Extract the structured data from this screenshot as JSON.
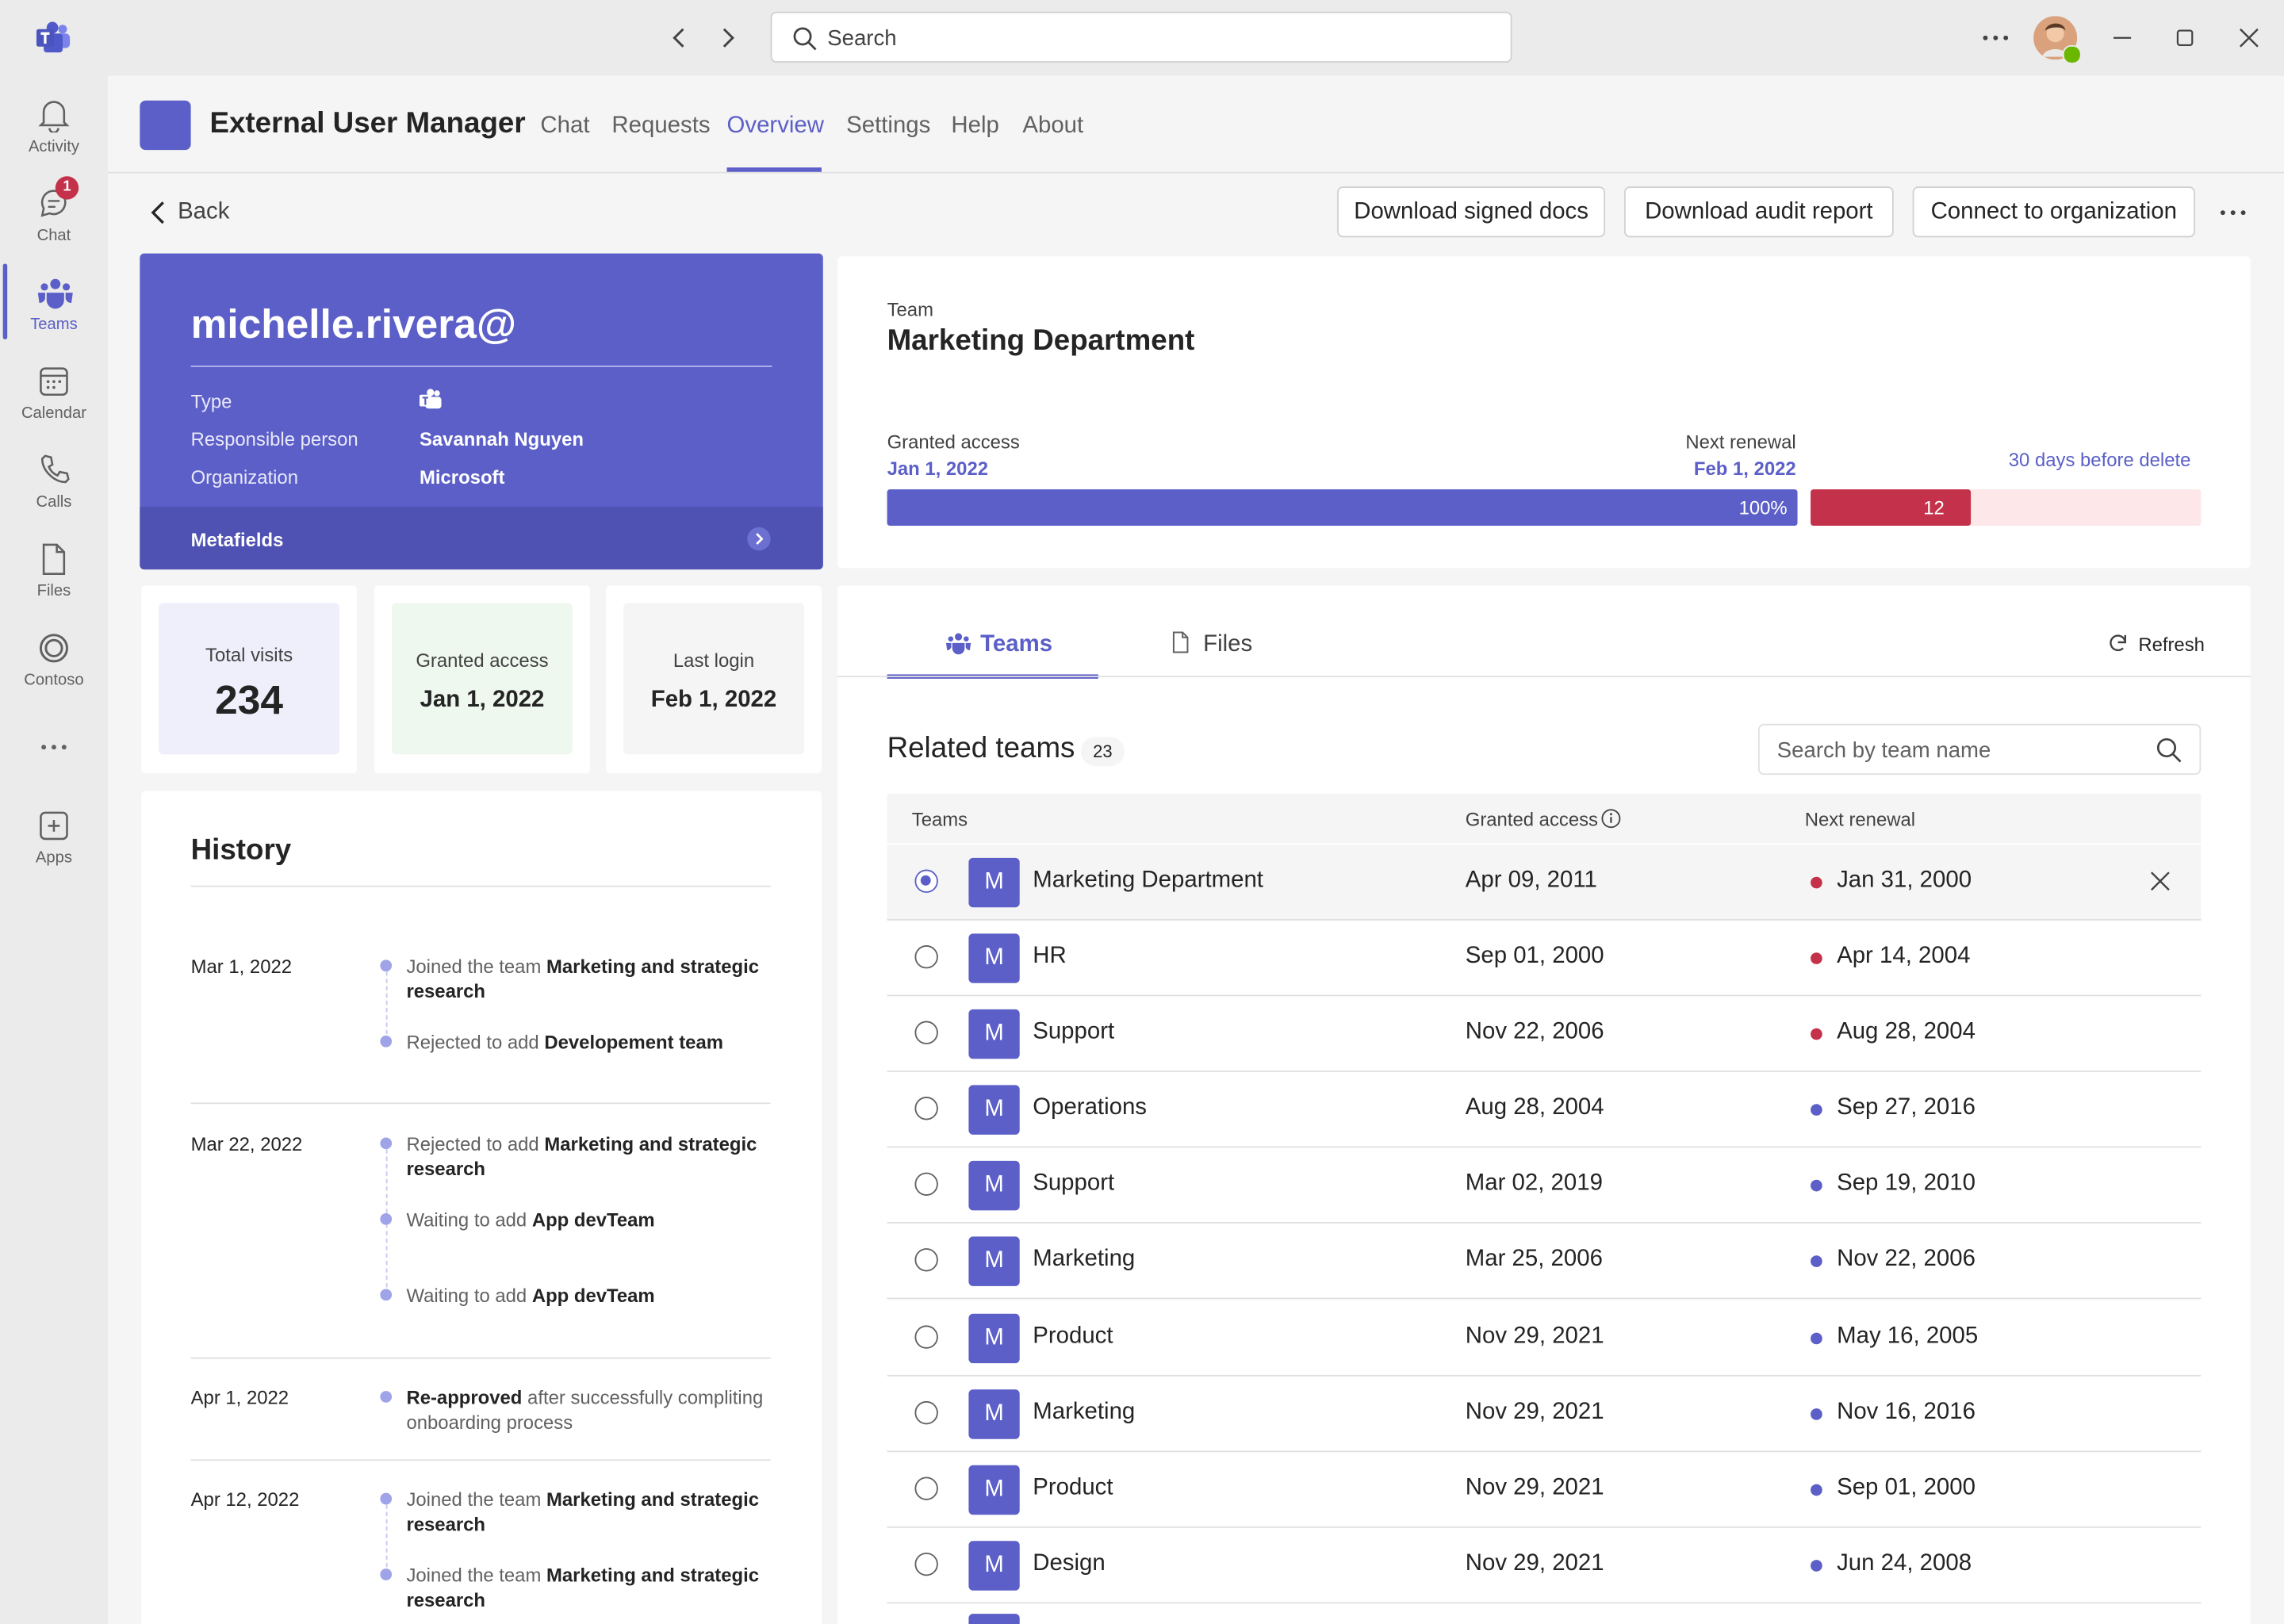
{
  "titlebar": {
    "search_placeholder": "Search"
  },
  "rail": {
    "items": [
      {
        "label": "Activity",
        "icon": "bell-icon"
      },
      {
        "label": "Chat",
        "icon": "chat-icon",
        "badge": "1"
      },
      {
        "label": "Teams",
        "icon": "teams-icon"
      },
      {
        "label": "Calendar",
        "icon": "calendar-icon"
      },
      {
        "label": "Calls",
        "icon": "phone-icon"
      },
      {
        "label": "Files",
        "icon": "file-icon"
      },
      {
        "label": "Contoso",
        "icon": "contoso-icon"
      },
      {
        "label": "Apps",
        "icon": "apps-icon"
      }
    ]
  },
  "app": {
    "title": "External User Manager",
    "tabs": [
      "Chat",
      "Requests",
      "Overview",
      "Settings",
      "Help",
      "About"
    ],
    "active_tab": "Overview"
  },
  "toolbar": {
    "back": "Back",
    "download_signed_docs": "Download signed docs",
    "download_audit_report": "Download audit report",
    "connect_to_organization": "Connect to organization"
  },
  "profile": {
    "email": "michelle.rivera@",
    "type_label": "Type",
    "responsible_label": "Responsible person",
    "responsible_value": "Savannah Nguyen",
    "organization_label": "Organization",
    "organization_value": "Microsoft",
    "metafields": "Metafields"
  },
  "stats": [
    {
      "label": "Total visits",
      "value": "234"
    },
    {
      "label": "Granted access",
      "value": "Jan 1, 2022"
    },
    {
      "label": "Last login",
      "value": "Feb 1, 2022"
    }
  ],
  "history": {
    "title": "History",
    "entries": [
      {
        "date": "Mar 1, 2022",
        "events": [
          {
            "pre": "Joined the team ",
            "bold": "Marketing and strategic research",
            "post": ""
          },
          {
            "pre": "Rejected to add ",
            "bold": "Developement team",
            "post": ""
          }
        ]
      },
      {
        "date": "Mar 22, 2022",
        "events": [
          {
            "pre": "Rejected to add ",
            "bold": "Marketing and strategic research",
            "post": ""
          },
          {
            "pre": "Waiting to add ",
            "bold": "App devTeam",
            "post": ""
          },
          {
            "pre": "Waiting to add ",
            "bold": "App devTeam",
            "post": ""
          }
        ]
      },
      {
        "date": "Apr 1, 2022",
        "events": [
          {
            "pre": "",
            "bold": "Re-approved",
            "post": " after successfully compliting onboarding process"
          }
        ]
      },
      {
        "date": "Apr 12, 2022",
        "events": [
          {
            "pre": "Joined the team ",
            "bold": "Marketing and strategic research",
            "post": ""
          },
          {
            "pre": "Joined the team ",
            "bold": "Marketing and strategic research",
            "post": ""
          }
        ]
      }
    ]
  },
  "team_card": {
    "kicker": "Team",
    "name": "Marketing Department",
    "granted_label": "Granted access",
    "granted_date": "Jan 1, 2022",
    "renewal_label": "Next renewal",
    "renewal_date": "Feb 1, 2022",
    "progress_label": "100%",
    "progress_fraction": 1.0,
    "delete_count": "12",
    "delete_fraction": 0.41,
    "delete_note": "30 days before delete"
  },
  "teams_panel": {
    "tabs": [
      "Teams",
      "Files"
    ],
    "active_tab": "Teams",
    "refresh": "Refresh",
    "related_title": "Related teams",
    "related_count": "23",
    "search_placeholder": "Search by team name",
    "columns": [
      "Teams",
      "Granted access",
      "Next renewal"
    ],
    "rows": [
      {
        "initial": "M",
        "name": "Marketing Department",
        "granted": "Apr 09, 2011",
        "renewal": "Jan 31, 2000",
        "status": "red",
        "selected": true
      },
      {
        "initial": "M",
        "name": "HR",
        "granted": "Sep 01, 2000",
        "renewal": "Apr 14, 2004",
        "status": "red",
        "selected": false
      },
      {
        "initial": "M",
        "name": "Support",
        "granted": "Nov 22, 2006",
        "renewal": "Aug 28, 2004",
        "status": "red",
        "selected": false
      },
      {
        "initial": "M",
        "name": "Operations",
        "granted": "Aug 28, 2004",
        "renewal": "Sep 27, 2016",
        "status": "blue",
        "selected": false
      },
      {
        "initial": "M",
        "name": "Support",
        "granted": "Mar 02, 2019",
        "renewal": "Sep 19, 2010",
        "status": "blue",
        "selected": false
      },
      {
        "initial": "M",
        "name": "Marketing",
        "granted": "Mar 25, 2006",
        "renewal": "Nov 22, 2006",
        "status": "blue",
        "selected": false
      },
      {
        "initial": "M",
        "name": "Product",
        "granted": "Nov 29, 2021",
        "renewal": "May 16, 2005",
        "status": "blue",
        "selected": false
      },
      {
        "initial": "M",
        "name": "Marketing",
        "granted": "Nov 29, 2021",
        "renewal": "Nov 16, 2016",
        "status": "blue",
        "selected": false
      },
      {
        "initial": "M",
        "name": "Product",
        "granted": "Nov 29, 2021",
        "renewal": "Sep 01, 2000",
        "status": "blue",
        "selected": false
      },
      {
        "initial": "M",
        "name": "Design",
        "granted": "Nov 29, 2021",
        "renewal": "Jun 24, 2008",
        "status": "blue",
        "selected": false
      }
    ]
  },
  "colors": {
    "accent": "#5b5fc7",
    "danger": "#c4314b",
    "danger_light": "#fde7e9",
    "status_red": "#c4314b",
    "status_blue": "#5b5fc7"
  }
}
